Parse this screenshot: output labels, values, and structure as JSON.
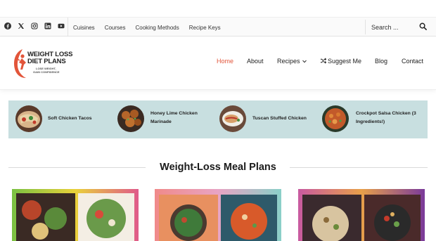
{
  "topbar": {
    "social_icons": [
      "facebook-icon",
      "x-twitter-icon",
      "instagram-icon",
      "linkedin-icon",
      "youtube-icon"
    ],
    "nav": [
      {
        "label": "Cuisines"
      },
      {
        "label": "Courses"
      },
      {
        "label": "Cooking Methods"
      },
      {
        "label": "Recipe Keys"
      }
    ],
    "search": {
      "placeholder": "Search ...",
      "icon": "search-icon"
    }
  },
  "brand": {
    "line1": "WEIGHT LOSS",
    "line2": "DIET PLANS",
    "tagline1": "LOSE WEIGHT,",
    "tagline2": "GAIN CONFIDENCE",
    "accent": "#e2553a"
  },
  "mainnav": {
    "home": "Home",
    "about": "About",
    "recipes": "Recipes",
    "suggest": "Suggest Me",
    "blog": "Blog",
    "contact": "Contact"
  },
  "featured": [
    {
      "title": "Soft Chicken Tacos"
    },
    {
      "title1": "Honey Lime Chicken",
      "title2": "Marinade"
    },
    {
      "title": "Tuscan Stuffed Chicken"
    },
    {
      "title1": "Crockpot Salsa Chicken (3",
      "title2": "Ingredients!)"
    }
  ],
  "section": {
    "title": "Weight-Loss Meal Plans"
  },
  "colors": {
    "accent": "#e2553a",
    "featured_bg": "#c8dfe0",
    "text": "#1a1a1a"
  }
}
